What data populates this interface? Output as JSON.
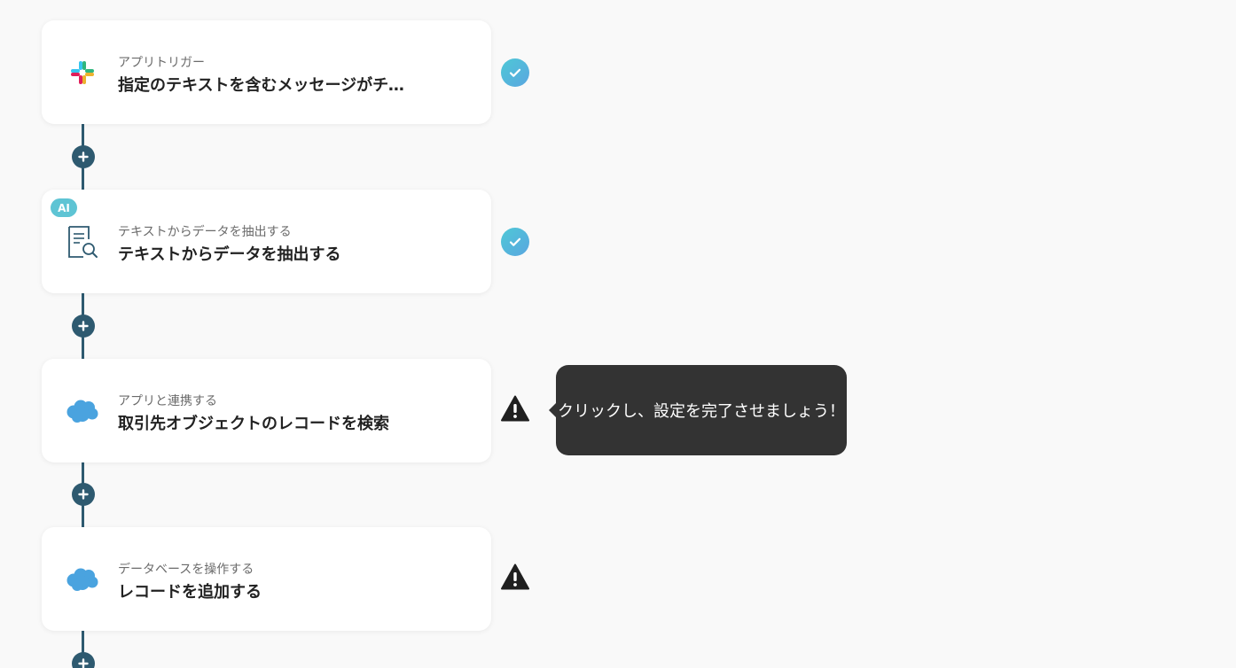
{
  "steps": [
    {
      "type_label": "アプリトリガー",
      "title": "指定のテキストを含むメッセージがチャンネルに投稿されたら",
      "icon": "slack-icon",
      "badge": "",
      "status": "complete"
    },
    {
      "type_label": "テキストからデータを抽出する",
      "title": "テキストからデータを抽出する",
      "icon": "document-search-icon",
      "badge": "AI",
      "status": "complete"
    },
    {
      "type_label": "アプリと連携する",
      "title": "取引先オブジェクトのレコードを検索",
      "icon": "salesforce-icon",
      "badge": "",
      "status": "warning"
    },
    {
      "type_label": "データベースを操作する",
      "title": "レコードを追加する",
      "icon": "salesforce-icon",
      "badge": "",
      "status": "warning"
    }
  ],
  "tooltip": {
    "text": "クリックし、設定を完了させましょう！"
  },
  "colors": {
    "connector": "#2e5a70",
    "check_gradient_start": "#4ec8d6",
    "check_gradient_end": "#5aa6e0",
    "warning": "#1f1f1f",
    "salesforce": "#4aa3df",
    "tooltip_bg": "#333333",
    "ai_badge": "#5ec4d4"
  }
}
